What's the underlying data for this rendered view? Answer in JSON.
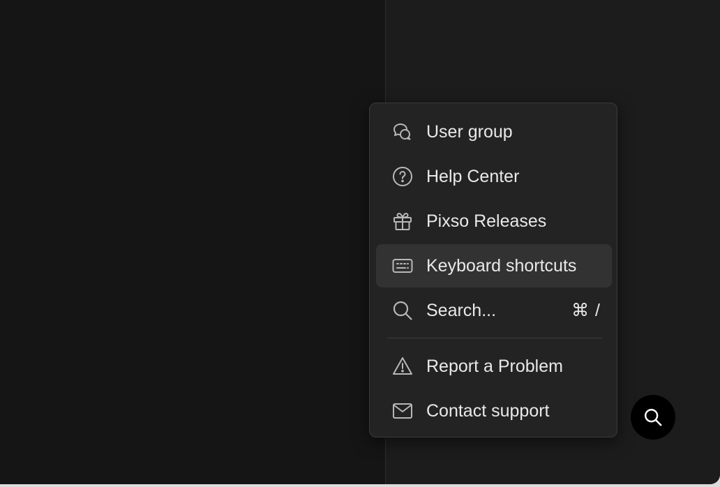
{
  "menu": {
    "items": [
      {
        "label": "User group",
        "icon": "chat-bubbles-icon"
      },
      {
        "label": "Help Center",
        "icon": "question-circle-icon"
      },
      {
        "label": "Pixso Releases",
        "icon": "gift-icon"
      },
      {
        "label": "Keyboard shortcuts",
        "icon": "keyboard-icon",
        "highlighted": true
      },
      {
        "label": "Search...",
        "icon": "search-icon",
        "shortcut": "⌘ /"
      },
      {
        "label": "Report a Problem",
        "icon": "warning-icon"
      },
      {
        "label": "Contact support",
        "icon": "mail-icon"
      }
    ]
  },
  "fab": {
    "icon": "search-icon"
  },
  "colors": {
    "menu_bg": "#232323",
    "highlight": "#323232",
    "text": "#e9e9e9",
    "icon": "#b8b8b8"
  }
}
